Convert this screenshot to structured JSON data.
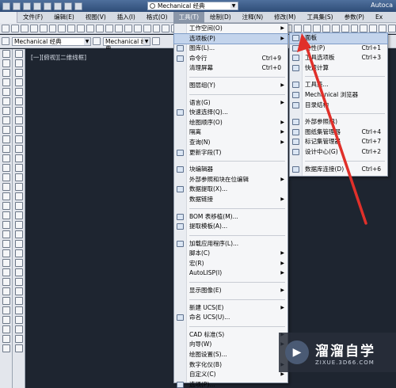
{
  "window": {
    "workspace": "Mechanical 经典",
    "app_title": "Autoca"
  },
  "menubar": {
    "items": [
      "文件(F)",
      "编辑(E)",
      "视图(V)",
      "插入(I)",
      "格式(O)",
      "工具(T)",
      "绘制(D)",
      "注释(N)",
      "修改(M)",
      "工具集(S)",
      "参数(P)",
      "Ex"
    ],
    "active": "工具(T)"
  },
  "toolbar2": {
    "style_select": "Mechanical 经典",
    "layer_select": "Mechanical 经典"
  },
  "canvas": {
    "viewport_label": "[一][俯视][二维线框]"
  },
  "tools_menu": {
    "items": [
      {
        "label": "工作空间(O)",
        "shortcut": "",
        "submenu": true,
        "icon": false
      },
      {
        "label": "选项板(P)",
        "shortcut": "",
        "submenu": true,
        "icon": false,
        "highlighted": true
      },
      {
        "label": "图库(L)...",
        "shortcut": "",
        "submenu": false,
        "icon": true
      },
      {
        "label": "命令行",
        "shortcut": "Ctrl+9",
        "submenu": false,
        "icon": true
      },
      {
        "label": "清理屏幕",
        "shortcut": "Ctrl+0",
        "submenu": false,
        "icon": false
      },
      {
        "sep": true
      },
      {
        "label": "图层组(Y)",
        "shortcut": "",
        "submenu": true,
        "icon": false
      },
      {
        "sep": true
      },
      {
        "label": "语言(G)",
        "shortcut": "",
        "submenu": true,
        "icon": false
      },
      {
        "label": "快速选择(Q)...",
        "shortcut": "",
        "submenu": false,
        "icon": true
      },
      {
        "label": "绘图顺序(O)",
        "shortcut": "",
        "submenu": true,
        "icon": false
      },
      {
        "label": "隔离",
        "shortcut": "",
        "submenu": true,
        "icon": false
      },
      {
        "label": "查询(N)",
        "shortcut": "",
        "submenu": true,
        "icon": false
      },
      {
        "label": "更新字段(T)",
        "shortcut": "",
        "submenu": false,
        "icon": true
      },
      {
        "sep": true
      },
      {
        "label": "块编辑器",
        "shortcut": "",
        "submenu": false,
        "icon": true
      },
      {
        "label": "外部参照和块在位编辑",
        "shortcut": "",
        "submenu": true,
        "icon": false
      },
      {
        "label": "数据提取(X)...",
        "shortcut": "",
        "submenu": false,
        "icon": true
      },
      {
        "label": "数据链接",
        "shortcut": "",
        "submenu": true,
        "icon": false
      },
      {
        "sep": true
      },
      {
        "label": "BOM 表移植(M)...",
        "shortcut": "",
        "submenu": false,
        "icon": true
      },
      {
        "label": "提取模板(A)...",
        "shortcut": "",
        "submenu": false,
        "icon": true
      },
      {
        "sep": true
      },
      {
        "label": "加载应用程序(L)...",
        "shortcut": "",
        "submenu": false,
        "icon": true
      },
      {
        "label": "脚本(C)",
        "shortcut": "",
        "submenu": true,
        "icon": false
      },
      {
        "label": "宏(R)",
        "shortcut": "",
        "submenu": true,
        "icon": false
      },
      {
        "label": "AutoLISP(I)",
        "shortcut": "",
        "submenu": true,
        "icon": false
      },
      {
        "sep": true
      },
      {
        "label": "显示图像(E)",
        "shortcut": "",
        "submenu": true,
        "icon": false
      },
      {
        "sep": true
      },
      {
        "label": "新建 UCS(E)",
        "shortcut": "",
        "submenu": true,
        "icon": false
      },
      {
        "label": "命名 UCS(U)...",
        "shortcut": "",
        "submenu": false,
        "icon": true
      },
      {
        "sep": true
      },
      {
        "label": "CAD 标准(S)",
        "shortcut": "",
        "submenu": true,
        "icon": false
      },
      {
        "label": "向导(W)",
        "shortcut": "",
        "submenu": true,
        "icon": false
      },
      {
        "label": "绘图设置(S)...",
        "shortcut": "",
        "submenu": false,
        "icon": false
      },
      {
        "label": "数字化仪(B)",
        "shortcut": "",
        "submenu": true,
        "icon": false
      },
      {
        "label": "自定义(C)",
        "shortcut": "",
        "submenu": true,
        "icon": false
      },
      {
        "label": "选项(P)...",
        "shortcut": "",
        "submenu": false,
        "icon": true
      }
    ]
  },
  "palettes_submenu": {
    "items": [
      {
        "label": "面板",
        "shortcut": "",
        "highlighted": true
      },
      {
        "label": "特性(P)",
        "shortcut": "Ctrl+1"
      },
      {
        "label": "工具选项板",
        "shortcut": "Ctrl+3"
      },
      {
        "label": "快速计算",
        "shortcut": ""
      },
      {
        "sep": true
      },
      {
        "label": "工具集...",
        "shortcut": ""
      },
      {
        "label": "Mechanical 浏览器",
        "shortcut": ""
      },
      {
        "label": "目录结构",
        "shortcut": ""
      },
      {
        "sep": true
      },
      {
        "label": "外部参照(R)",
        "shortcut": ""
      },
      {
        "label": "图纸集管理器",
        "shortcut": "Ctrl+4"
      },
      {
        "label": "标记集管理器",
        "shortcut": "Ctrl+7"
      },
      {
        "label": "设计中心(G)",
        "shortcut": "Ctrl+2"
      },
      {
        "sep": true
      },
      {
        "label": "数据库连接(D)",
        "shortcut": "Ctrl+6"
      }
    ]
  },
  "watermark": {
    "name": "溜溜自学",
    "url": "ZIXUE.3D66.COM"
  },
  "colors": {
    "canvas": "#1e2530",
    "menu_bg": "#f5f6f8",
    "highlight": "#c3d4ec",
    "annotation_arrow": "#e0302a"
  }
}
